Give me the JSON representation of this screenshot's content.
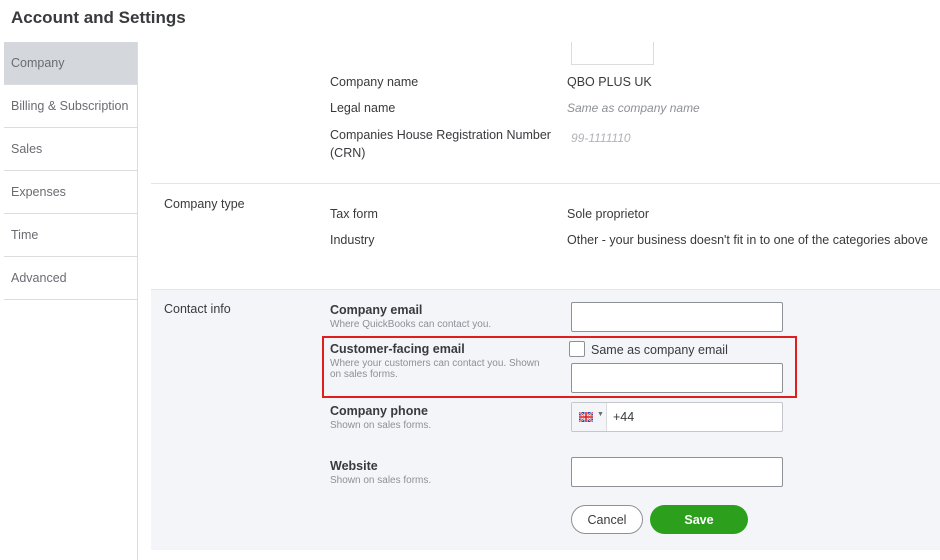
{
  "page": {
    "title": "Account and Settings"
  },
  "sidebar": {
    "items": [
      {
        "label": "Company",
        "active": true
      },
      {
        "label": "Billing & Subscription"
      },
      {
        "label": "Sales"
      },
      {
        "label": "Expenses"
      },
      {
        "label": "Time"
      },
      {
        "label": "Advanced"
      }
    ]
  },
  "company_name_section": {
    "company_name_label": "Company name",
    "company_name_value": "QBO PLUS UK",
    "legal_name_label": "Legal name",
    "legal_name_value": "Same as company name",
    "crn_label_line1": "Companies House Registration Number",
    "crn_label_line2": "(CRN)",
    "crn_value": "99-1111110"
  },
  "company_type": {
    "section_label": "Company type",
    "tax_form_label": "Tax form",
    "tax_form_value": "Sole proprietor",
    "industry_label": "Industry",
    "industry_value": "Other - your business doesn't fit in to one of the categories above"
  },
  "contact_info": {
    "section_label": "Contact info",
    "company_email_label": "Company email",
    "company_email_hint": "Where QuickBooks can contact you.",
    "company_email_value": "",
    "customer_email_label": "Customer-facing email",
    "customer_email_hint_line1": "Where your customers can contact you. Shown",
    "customer_email_hint_line2": "on sales forms.",
    "same_as_label": "Same as company email",
    "same_as_checked": false,
    "customer_email_value": "",
    "phone_label": "Company phone",
    "phone_hint": "Shown on sales forms.",
    "phone_country_flag": "uk-flag-icon",
    "phone_value": "+44",
    "website_label": "Website",
    "website_hint": "Shown on sales forms.",
    "website_value": ""
  },
  "actions": {
    "cancel_label": "Cancel",
    "save_label": "Save"
  },
  "colors": {
    "save_green": "#2ca01c",
    "highlight_red": "#e01e1e",
    "panel_bg": "#f4f5f8",
    "active_nav_bg": "#d4d7dc"
  }
}
